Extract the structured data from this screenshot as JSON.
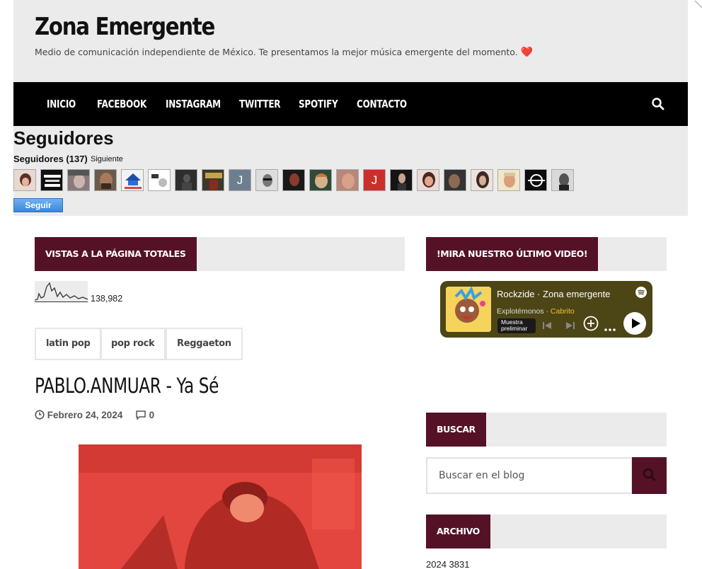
{
  "header": {
    "site_title": "Zona Emergente",
    "site_description": "Medio de comunicación independiente de México. Te presentamos la mejor música emergente del momento.",
    "heart_glyph": "❤️"
  },
  "nav": {
    "items": [
      "INICIO",
      "FACEBOOK",
      "INSTAGRAM",
      "TWITTER",
      "SPOTIFY",
      "CONTACTO"
    ],
    "search_icon": "search-icon"
  },
  "followers": {
    "title": "Seguidores",
    "count_label": "Seguidores (137)",
    "next_label": "Siguiente",
    "avatar_letters": [
      "J",
      "J"
    ],
    "follow_button": "Seguir"
  },
  "widgets": {
    "page_views_title": "VISTAS A LA PÁGINA TOTALES",
    "page_views_count": "138,982",
    "video_title": "!MIRA NUESTRO ÚLTIMO VIDEO!",
    "search_title": "BUSCAR",
    "archive_title": "ARCHIVO"
  },
  "tags": [
    "latin pop",
    "pop rock",
    "Reggaeton"
  ],
  "post": {
    "title": "PABLO.ANMUAR - Ya Sé",
    "date": "Febrero 24, 2024",
    "comments": "0"
  },
  "spotify": {
    "title": "Rockzide · Zona emergente",
    "track": "Explotémonos",
    "artist": "Cabrito",
    "preview_label": "Muestra preliminar"
  },
  "search": {
    "placeholder": "Buscar en el blog"
  },
  "archive": {
    "first_year": "2024",
    "first_count": "3831"
  },
  "colors": {
    "accent": "#551227",
    "nav_bg": "#000000",
    "header_bg": "#ebebeb",
    "spotify_bg": "#4c4516",
    "follow_button": "#3a86da"
  }
}
